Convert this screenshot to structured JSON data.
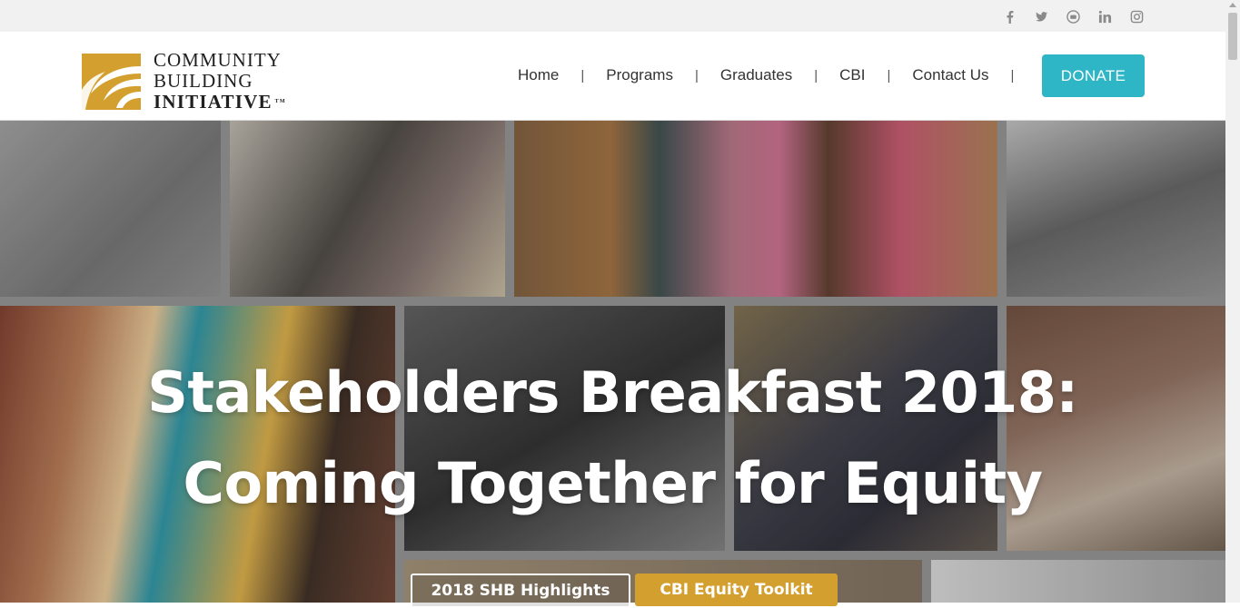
{
  "social": [
    {
      "name": "facebook-icon",
      "glyph": "f"
    },
    {
      "name": "twitter-icon",
      "glyph": "twitter"
    },
    {
      "name": "youtube-icon",
      "glyph": "yt"
    },
    {
      "name": "linkedin-icon",
      "glyph": "in"
    },
    {
      "name": "instagram-icon",
      "glyph": "ig"
    }
  ],
  "logo": {
    "line1": "COMMUNITY",
    "line2": "BUILDING",
    "line3": "INITIATIVE",
    "tm": "TM",
    "brand_color": "#d3a030"
  },
  "nav": {
    "items": [
      "Home",
      "Programs",
      "Graduates",
      "CBI",
      "Contact Us"
    ],
    "separator": "|",
    "donate": "DONATE",
    "donate_color": "#2fb6c6"
  },
  "hero": {
    "title_line1": "Stakeholders Breakfast 2018:",
    "title_line2": "Coming Together for Equity",
    "button_highlights": "2018 SHB Highlights",
    "button_toolkit": "CBI Equity Toolkit",
    "toolkit_color": "#d3a030"
  }
}
